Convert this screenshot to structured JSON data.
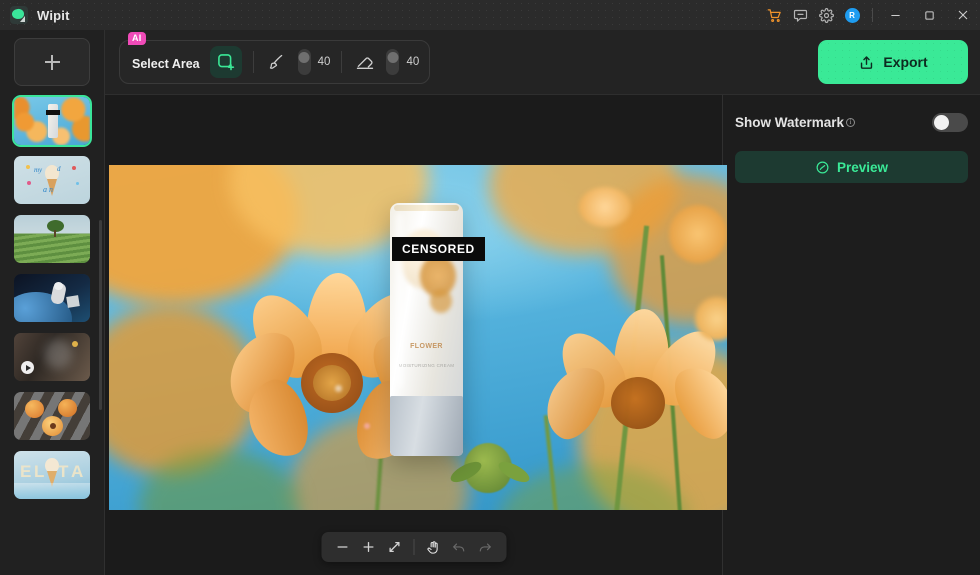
{
  "window": {
    "app_title": "Wipit",
    "logo_icon": "brain-logo-icon",
    "titlebar_icons": [
      {
        "name": "cart-icon",
        "label": "Store"
      },
      {
        "name": "feedback-icon",
        "label": "Feedback"
      },
      {
        "name": "gear-icon",
        "label": "Settings"
      },
      {
        "name": "avatar",
        "label": "R"
      }
    ],
    "controls": [
      {
        "name": "minimize-button",
        "label": "Minimize"
      },
      {
        "name": "maximize-button",
        "label": "Maximize"
      },
      {
        "name": "close-button",
        "label": "Close"
      }
    ]
  },
  "sidebar": {
    "add_button": {
      "label": "+",
      "icon": "plus-icon"
    },
    "items": [
      {
        "name": "thumbnail-flowers-product",
        "selected": true,
        "type": "image",
        "alt": "Orange flowers with cosmetic tube"
      },
      {
        "name": "thumbnail-ice-cream-text",
        "selected": false,
        "type": "image",
        "alt": "Ice cream cone with blue handwriting"
      },
      {
        "name": "thumbnail-hill-tree",
        "selected": false,
        "type": "image",
        "alt": "Green hill with a tree"
      },
      {
        "name": "thumbnail-astronaut",
        "selected": false,
        "type": "image",
        "alt": "Astronaut over Earth"
      },
      {
        "name": "thumbnail-video-clip",
        "selected": false,
        "type": "video",
        "alt": "Dark video clip"
      },
      {
        "name": "thumbnail-peaches",
        "selected": false,
        "type": "image",
        "alt": "Peaches on cloth"
      },
      {
        "name": "thumbnail-elta",
        "selected": false,
        "type": "image",
        "alt": "Ice cream with ELTA text"
      }
    ]
  },
  "toolbar": {
    "ai_badge": "AI",
    "select_area_label": "Select Area",
    "select_area_icon": "select-area-add-icon",
    "brush": {
      "icon": "brush-icon",
      "size": "40"
    },
    "eraser": {
      "icon": "eraser-icon",
      "size": "40"
    },
    "export": {
      "label": "Export",
      "icon": "export-upload-icon",
      "color": "#3ae997"
    }
  },
  "canvas": {
    "overlay_text": "CENSORED",
    "bottom_controls": [
      {
        "name": "zoom-out-button",
        "icon": "minus-icon",
        "enabled": true
      },
      {
        "name": "zoom-in-button",
        "icon": "plus-icon",
        "enabled": true
      },
      {
        "name": "fit-to-screen-button",
        "icon": "expand-arrows-icon",
        "enabled": true
      },
      {
        "name": "pan-tool-button",
        "icon": "hand-icon",
        "enabled": true
      },
      {
        "name": "undo-button",
        "icon": "undo-arrow-icon",
        "enabled": false
      },
      {
        "name": "redo-button",
        "icon": "redo-arrow-icon",
        "enabled": false
      }
    ]
  },
  "right_panel": {
    "watermark_label": "Show Watermark",
    "watermark_info_icon": "info-icon",
    "watermark_enabled": false,
    "preview": {
      "label": "Preview",
      "icon": "preview-eye-icon",
      "color": "#3ae997"
    }
  }
}
